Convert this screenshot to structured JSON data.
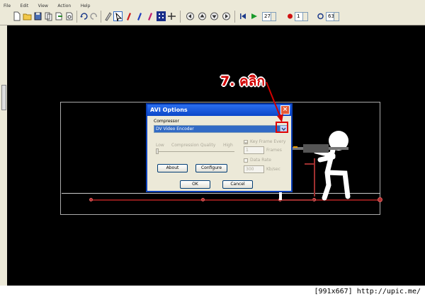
{
  "menu": {
    "items": [
      "File",
      "Edit",
      "View",
      "Action",
      "Help"
    ]
  },
  "toolbar": {
    "icons": [
      "new-file-icon",
      "open-folder-icon",
      "save-icon",
      "copy-figure-icon",
      "export-icon",
      "preview-icon",
      "undo-icon",
      "redo-icon",
      "select-icon",
      "pointer-icon",
      "red-figure-icon",
      "blue-figure-icon",
      "pink-figure-icon",
      "grid-icon",
      "timeline-icon",
      "frame-back-icon",
      "frame-up-icon",
      "frame-down-icon",
      "frame-forward-icon",
      "rewind-icon",
      "play-icon"
    ],
    "frame_value": "27",
    "onion_value": "1",
    "fps_value": "63"
  },
  "dialog": {
    "title": "AVI Options",
    "compressor_label": "Compressor",
    "compressor_value": "DV Video Encoder",
    "low_label": "Low",
    "quality_label": "Compression Quality",
    "high_label": "High",
    "keyframe_label": "Key Frame Every",
    "keyframe_value": "1",
    "frames_label": "Frames",
    "datarate_label": "Data Rate",
    "datarate_value": "300",
    "kbsec_label": "Kb/sec",
    "about_label": "About",
    "configure_label": "Configure",
    "ok_label": "OK",
    "cancel_label": "Cancel"
  },
  "annotation": {
    "text": "7. คลิก"
  },
  "watermark": {
    "text": "[991x667] http://upic.me/"
  },
  "colors": {
    "dialog_title_blue": "#0b47c8",
    "annotation_red": "#e00000",
    "timeline_red": "#8a1b1b"
  }
}
